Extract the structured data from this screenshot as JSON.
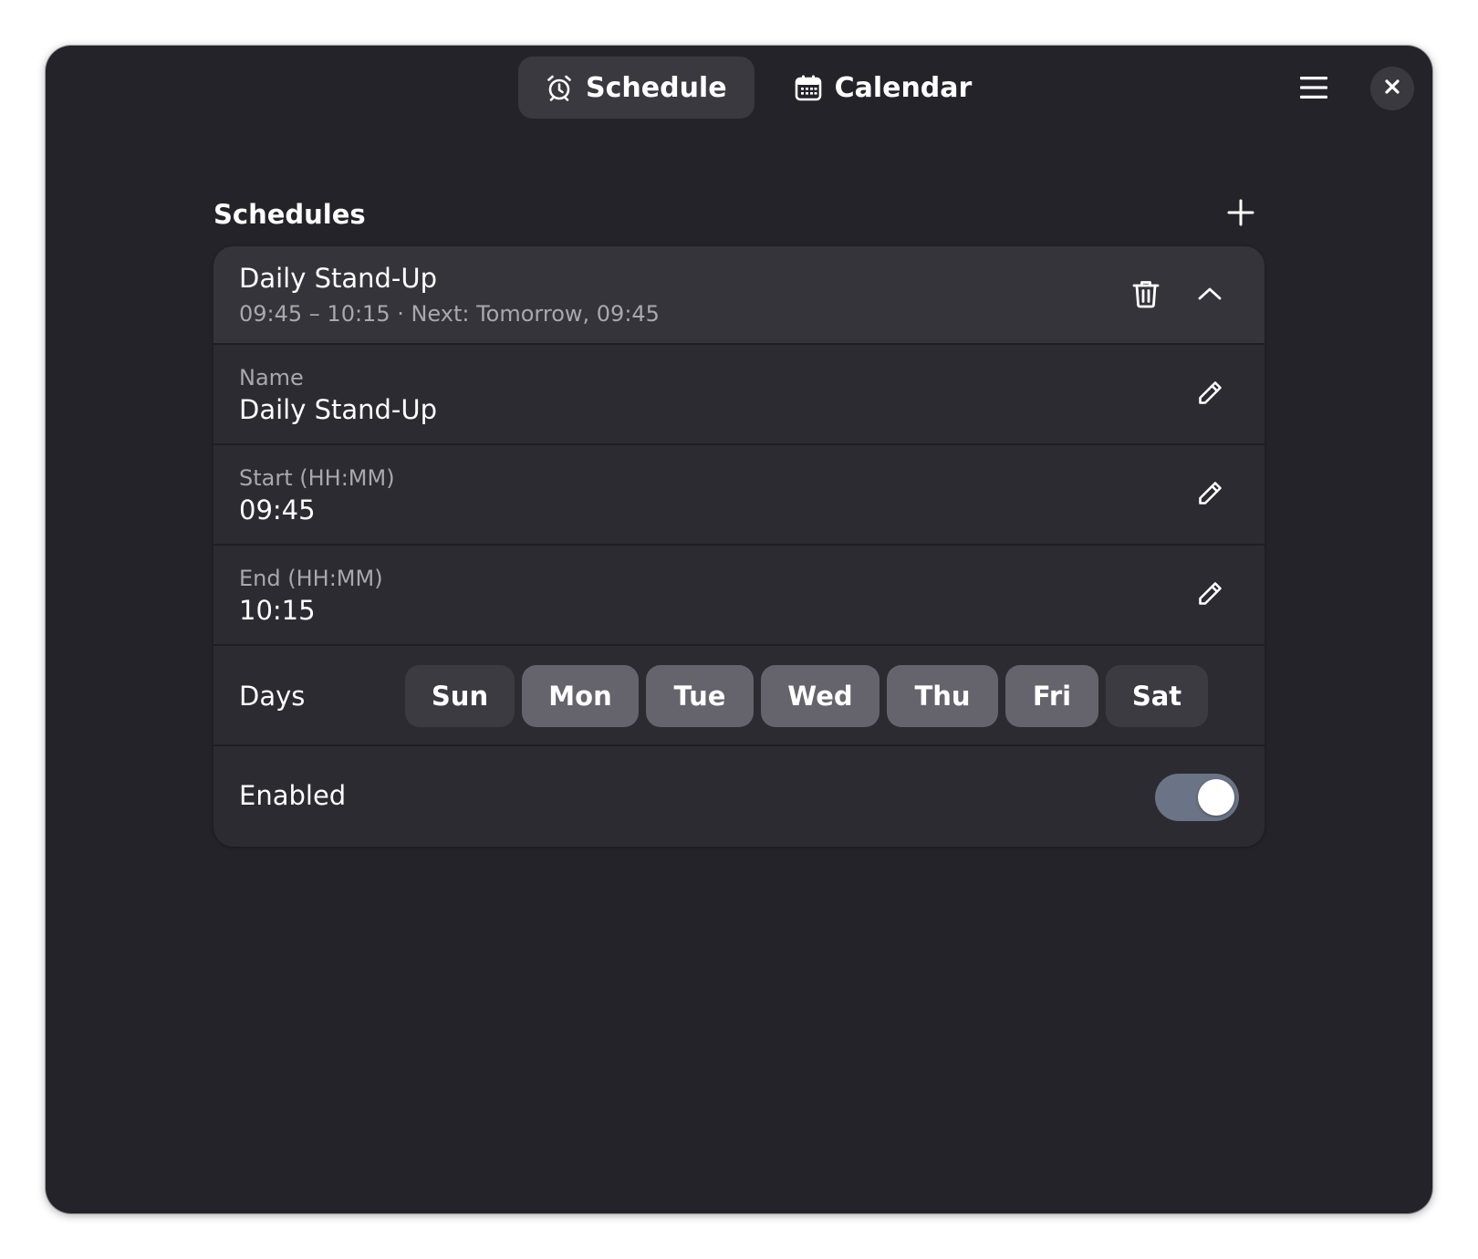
{
  "header": {
    "tabs": [
      {
        "label": "Schedule",
        "icon": "alarm-clock-icon",
        "active": true
      },
      {
        "label": "Calendar",
        "icon": "calendar-icon",
        "active": false
      }
    ],
    "menu_icon": "hamburger-menu-icon",
    "close_icon": "close-icon"
  },
  "section": {
    "title": "Schedules",
    "add_icon": "plus-icon"
  },
  "schedule": {
    "title": "Daily Stand-Up",
    "subtitle": "09:45 – 10:15 · Next: Tomorrow, 09:45",
    "fields": [
      {
        "label": "Name",
        "value": "Daily Stand-Up"
      },
      {
        "label": "Start (HH:MM)",
        "value": "09:45"
      },
      {
        "label": "End (HH:MM)",
        "value": "10:15"
      }
    ],
    "days_label": "Days",
    "days": [
      {
        "label": "Sun",
        "selected": false
      },
      {
        "label": "Mon",
        "selected": true
      },
      {
        "label": "Tue",
        "selected": true
      },
      {
        "label": "Wed",
        "selected": true
      },
      {
        "label": "Thu",
        "selected": true
      },
      {
        "label": "Fri",
        "selected": true
      },
      {
        "label": "Sat",
        "selected": false
      }
    ],
    "enabled_label": "Enabled",
    "enabled": true
  },
  "colors": {
    "window_bg": "#242329",
    "card_bg": "#2c2b31",
    "day_selected": "#65646c",
    "day_unselected": "#3c3b42",
    "toggle_on": "#6a7486"
  }
}
